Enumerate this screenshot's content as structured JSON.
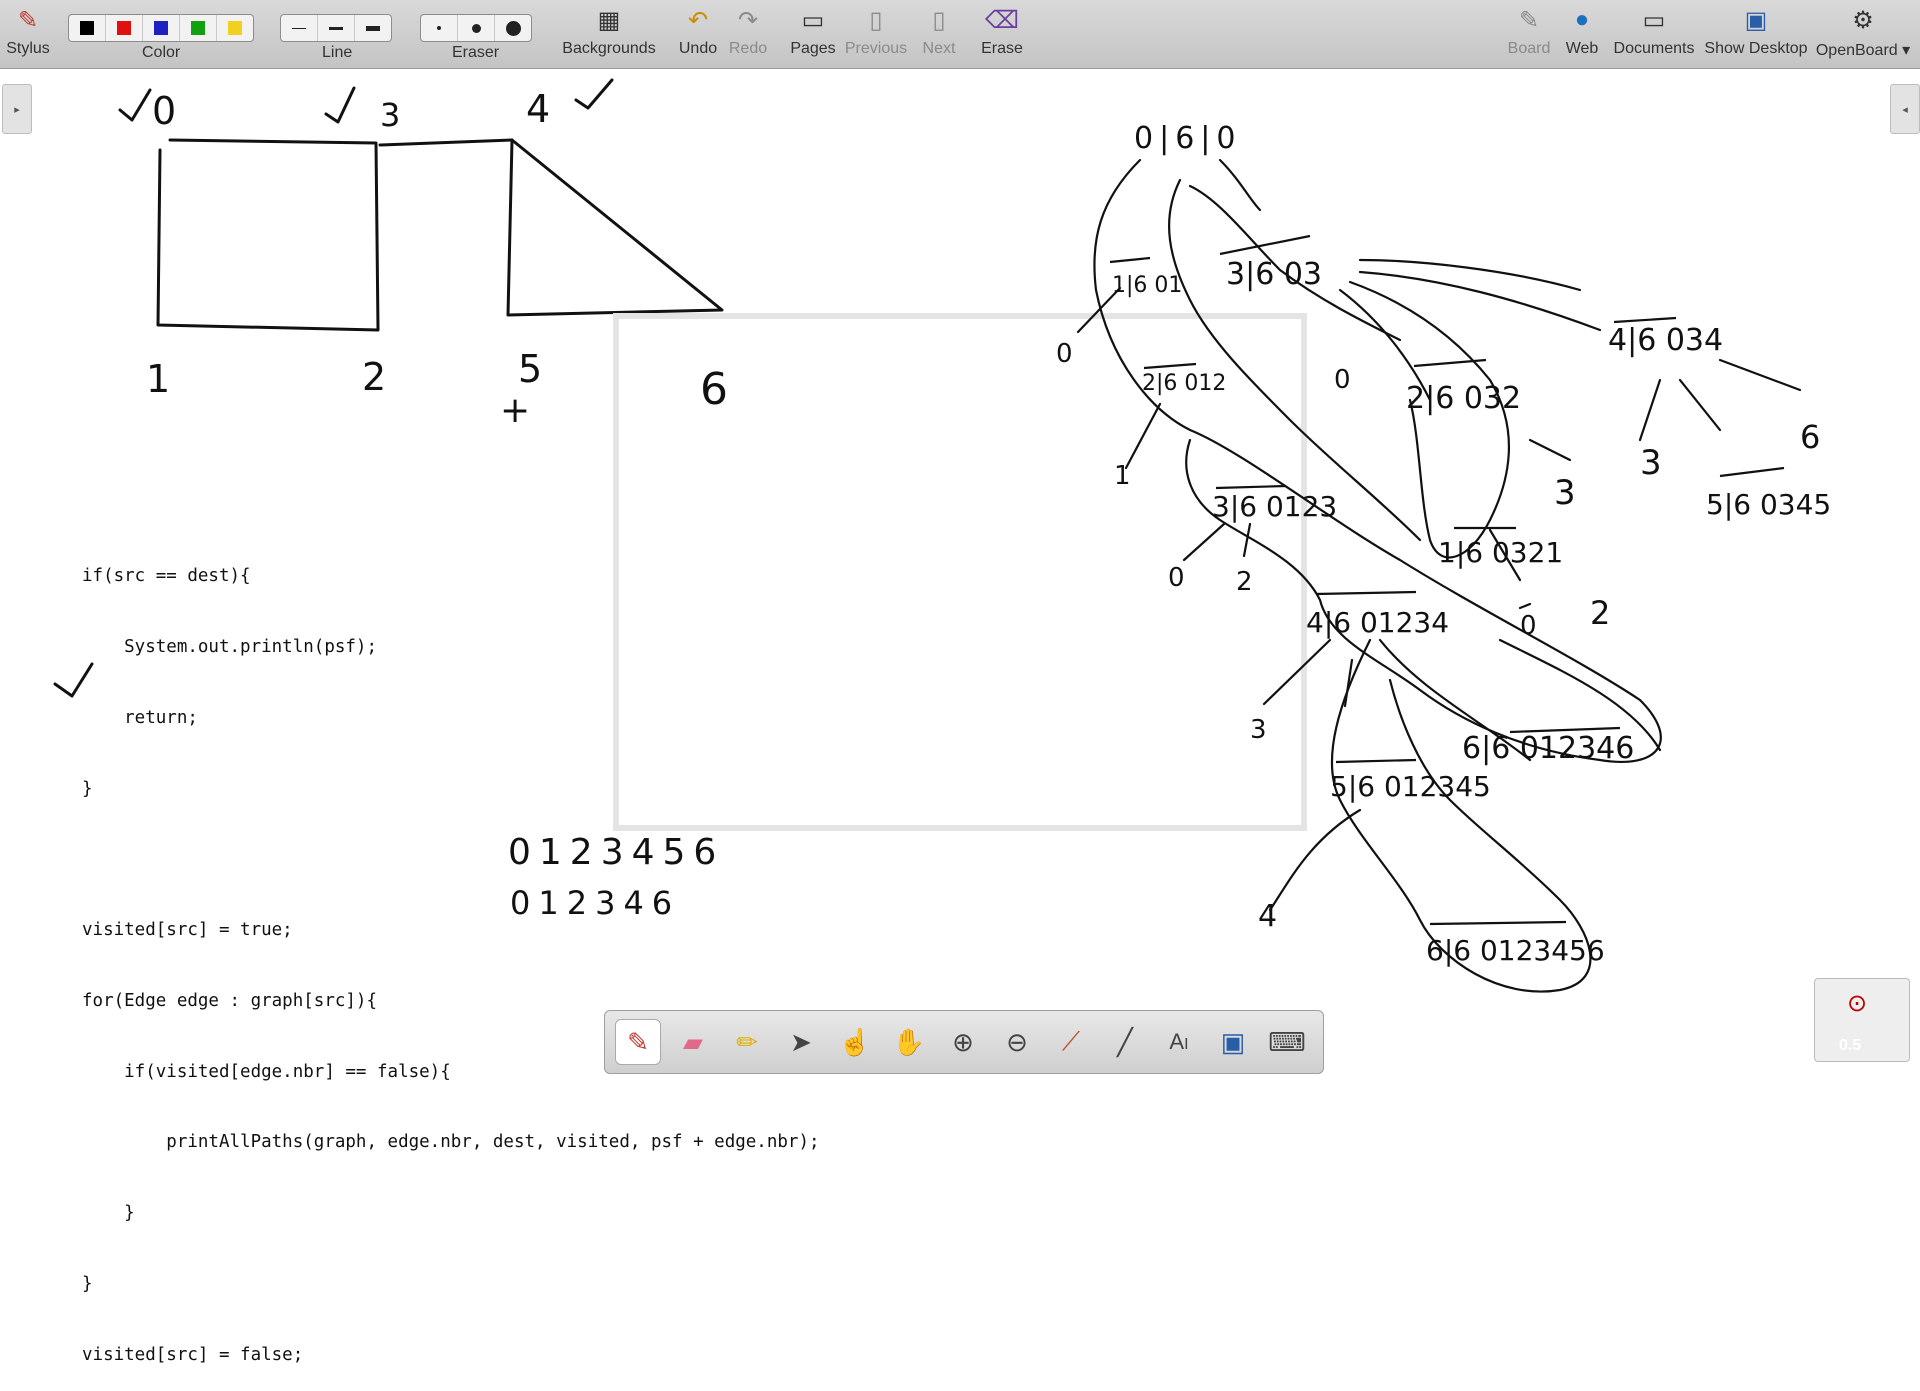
{
  "toolbar": {
    "stylus": "Stylus",
    "color": "Color",
    "line": "Line",
    "eraser": "Eraser",
    "backgrounds": "Backgrounds",
    "undo": "Undo",
    "redo": "Redo",
    "pages": "Pages",
    "previous": "Previous",
    "next": "Next",
    "erase": "Erase",
    "board": "Board",
    "web": "Web",
    "documents": "Documents",
    "show_desktop": "Show Desktop",
    "openboard": "OpenBoard",
    "colors": [
      "#000000",
      "#e01010",
      "#2020c0",
      "#10a010",
      "#f0d020"
    ]
  },
  "code": {
    "lines": [
      "if(src == dest){",
      "    System.out.println(psf);",
      "    return;",
      "}",
      "",
      "visited[src] = true;",
      "for(Edge edge : graph[src]){",
      "    if(visited[edge.nbr] == false){",
      "        printAllPaths(graph, edge.nbr, dest, visited, psf + edge.nbr);",
      "    }",
      "}",
      "visited[src] = false;"
    ]
  },
  "graph": {
    "node_labels": [
      "0",
      "3",
      "4",
      "1",
      "2",
      "5",
      "6"
    ],
    "paths": [
      "0123456",
      "012346"
    ]
  },
  "tree": {
    "root": "0|6|0",
    "nodes": [
      "1|6 01",
      "3|6 03",
      "4|6 034",
      "2|6 012",
      "2|6 032",
      "3|6 0123",
      "1|6 0321",
      "5|6 0345",
      "4|6 01234",
      "5|6 012345",
      "6|6 012346",
      "6|6 0123456"
    ],
    "leaf_marks": [
      "0",
      "0",
      "1",
      "0",
      "2",
      "3",
      "3",
      "6",
      "3",
      "0",
      "2",
      "3",
      "4"
    ]
  },
  "dock": {
    "tools": [
      "pen-icon",
      "eraser-icon",
      "highlighter-icon",
      "pointer-icon",
      "laser-icon",
      "hand-icon",
      "zoom-in-icon",
      "zoom-out-icon",
      "dropper-icon",
      "line-icon",
      "text-icon",
      "capture-icon",
      "keyboard-icon"
    ]
  },
  "zoom": {
    "label": "0.5"
  }
}
